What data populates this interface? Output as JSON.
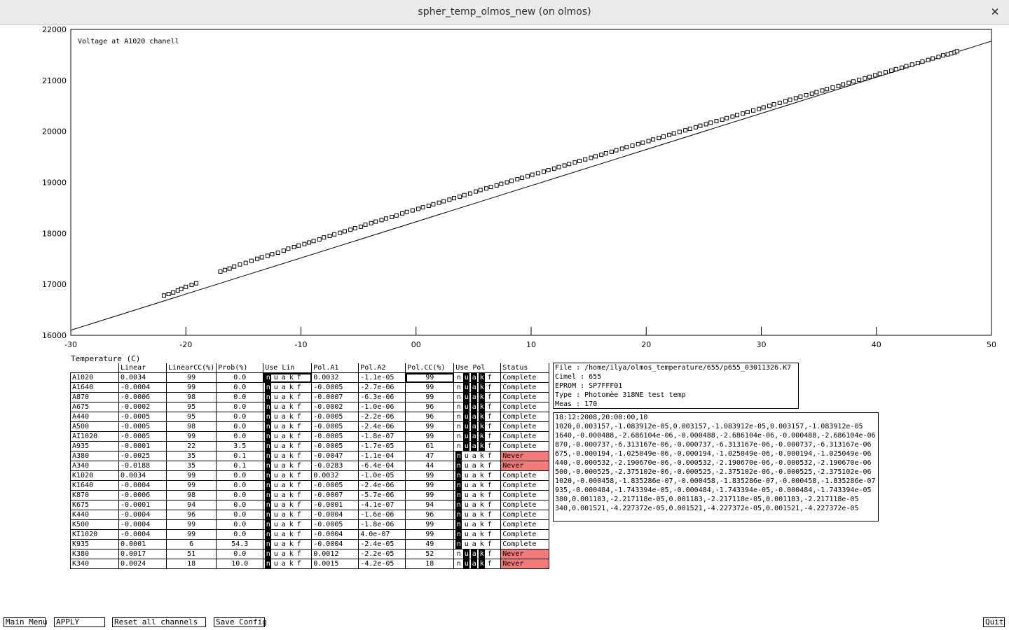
{
  "window": {
    "title": "spher_temp_olmos_new (on olmos)",
    "close_glyph": "✕"
  },
  "chart_data": {
    "type": "scatter",
    "annotation": "Voltage at A1020 chanell",
    "xlabel": "Temperature (C)",
    "ylabel": "",
    "xlim": [
      -30,
      50
    ],
    "ylim": [
      16000,
      22000
    ],
    "x_ticks": [
      "-30",
      "-20",
      "-10",
      "00",
      "10",
      "20",
      "30",
      "40",
      "50"
    ],
    "y_ticks": [
      "16000",
      "17000",
      "18000",
      "19000",
      "20000",
      "21000",
      "22000"
    ],
    "grid": false,
    "marker": "open-square",
    "fit_line": {
      "type": "linear",
      "x": [
        -30,
        50
      ],
      "y": [
        16100,
        21770
      ]
    },
    "scatter": {
      "x": [
        -21.9,
        -21.5,
        -21.1,
        -20.7,
        -20.4,
        -20.0,
        -19.5,
        -19.1,
        -17.0,
        -16.6,
        -16.2,
        -15.8,
        -15.3,
        -14.8,
        -14.3,
        -13.8,
        -13.4,
        -12.9,
        -12.5,
        -12.0,
        -11.5,
        -11.1,
        -10.6,
        -10.2,
        -9.7,
        -9.3,
        -8.9,
        -8.4,
        -8.0,
        -7.5,
        -7.1,
        -6.6,
        -6.2,
        -5.7,
        -5.3,
        -4.8,
        -4.4,
        -3.9,
        -3.5,
        -3.0,
        -2.6,
        -2.1,
        -1.7,
        -1.2,
        -0.8,
        -0.3,
        0.2,
        0.6,
        1.1,
        1.5,
        2.0,
        2.4,
        2.9,
        3.3,
        3.8,
        4.2,
        4.7,
        5.2,
        5.6,
        6.1,
        6.5,
        7.0,
        7.4,
        7.9,
        8.3,
        8.8,
        9.2,
        9.7,
        10.1,
        10.6,
        11.1,
        11.5,
        12.0,
        12.4,
        12.9,
        13.3,
        13.8,
        14.2,
        14.7,
        15.2,
        15.6,
        16.1,
        16.5,
        17.0,
        17.4,
        17.9,
        18.3,
        18.8,
        19.3,
        19.7,
        20.2,
        20.6,
        21.1,
        21.5,
        22.0,
        22.4,
        22.9,
        23.4,
        23.8,
        24.3,
        24.7,
        25.2,
        25.6,
        26.1,
        26.6,
        27.0,
        27.5,
        27.9,
        28.4,
        28.8,
        29.3,
        29.8,
        30.2,
        30.7,
        31.1,
        31.6,
        32.1,
        32.5,
        33.0,
        33.4,
        33.9,
        34.4,
        34.8,
        35.3,
        35.7,
        36.2,
        36.7,
        37.1,
        37.6,
        38.0,
        38.5,
        39.0,
        39.4,
        39.9,
        40.3,
        40.8,
        41.3,
        41.7,
        42.2,
        42.6,
        43.1,
        43.6,
        44.0,
        44.5,
        44.9,
        45.4,
        45.8,
        46.2,
        46.5,
        46.8,
        47.0
      ],
      "y": [
        16780,
        16810,
        16840,
        16880,
        16910,
        16950,
        16990,
        17020,
        17250,
        17280,
        17310,
        17350,
        17390,
        17420,
        17460,
        17500,
        17530,
        17560,
        17590,
        17620,
        17660,
        17700,
        17730,
        17760,
        17790,
        17820,
        17850,
        17880,
        17920,
        17950,
        17980,
        18010,
        18040,
        18070,
        18100,
        18130,
        18170,
        18200,
        18230,
        18260,
        18290,
        18320,
        18350,
        18390,
        18420,
        18450,
        18480,
        18510,
        18540,
        18570,
        18600,
        18630,
        18660,
        18690,
        18720,
        18750,
        18780,
        18820,
        18850,
        18880,
        18910,
        18940,
        18970,
        19000,
        19030,
        19060,
        19090,
        19120,
        19150,
        19180,
        19210,
        19240,
        19270,
        19300,
        19330,
        19360,
        19390,
        19420,
        19450,
        19480,
        19510,
        19540,
        19570,
        19600,
        19630,
        19660,
        19690,
        19720,
        19750,
        19780,
        19810,
        19840,
        19870,
        19900,
        19930,
        19960,
        19990,
        20020,
        20050,
        20080,
        20110,
        20140,
        20170,
        20200,
        20230,
        20260,
        20290,
        20320,
        20350,
        20380,
        20410,
        20440,
        20470,
        20500,
        20530,
        20560,
        20590,
        20620,
        20650,
        20680,
        20710,
        20740,
        20770,
        20800,
        20830,
        20860,
        20890,
        20920,
        20950,
        20980,
        21010,
        21040,
        21070,
        21100,
        21130,
        21160,
        21190,
        21220,
        21250,
        21280,
        21310,
        21340,
        21370,
        21400,
        21430,
        21460,
        21490,
        21510,
        21530,
        21550,
        21570,
        21590,
        21610
      ]
    }
  },
  "table": {
    "headers": [
      "",
      "Linear",
      "LinearCC(%)",
      "Prob(%)",
      "Use Lin",
      "Pol.A1",
      "Pol.A2",
      "Pol.CC(%)",
      "Use Pol",
      "Status"
    ],
    "toggle_letters": [
      "n",
      "u",
      "a",
      "k",
      "f"
    ],
    "rows": [
      {
        "ch": "A1020",
        "lin": "0.0034",
        "lincc": "99",
        "prob": "0.0",
        "uselin": "n",
        "a1": "0.0032",
        "a2": "-1.1e-05",
        "polcc": "99",
        "usepol": "uak",
        "status": "Complete"
      },
      {
        "ch": "A1640",
        "lin": "-0.0004",
        "lincc": "99",
        "prob": "0.0",
        "uselin": "n",
        "a1": "-0.0005",
        "a2": "-2.7e-06",
        "polcc": "99",
        "usepol": "uak",
        "status": "Complete"
      },
      {
        "ch": "A870",
        "lin": "-0.0006",
        "lincc": "98",
        "prob": "0.0",
        "uselin": "n",
        "a1": "-0.0007",
        "a2": "-6.3e-06",
        "polcc": "99",
        "usepol": "uak",
        "status": "Complete"
      },
      {
        "ch": "A675",
        "lin": "-0.0002",
        "lincc": "95",
        "prob": "0.0",
        "uselin": "n",
        "a1": "-0.0002",
        "a2": "-1.0e-06",
        "polcc": "96",
        "usepol": "uak",
        "status": "Complete"
      },
      {
        "ch": "A440",
        "lin": "-0.0005",
        "lincc": "95",
        "prob": "0.0",
        "uselin": "n",
        "a1": "-0.0005",
        "a2": "-2.2e-06",
        "polcc": "96",
        "usepol": "uak",
        "status": "Complete"
      },
      {
        "ch": "A500",
        "lin": "-0.0005",
        "lincc": "98",
        "prob": "0.0",
        "uselin": "n",
        "a1": "-0.0005",
        "a2": "-2.4e-06",
        "polcc": "99",
        "usepol": "uak",
        "status": "Complete"
      },
      {
        "ch": "AI1020",
        "lin": "-0.0005",
        "lincc": "99",
        "prob": "0.0",
        "uselin": "n",
        "a1": "-0.0005",
        "a2": "-1.8e-07",
        "polcc": "99",
        "usepol": "uak",
        "status": "Complete"
      },
      {
        "ch": "A935",
        "lin": "-0.0001",
        "lincc": "22",
        "prob": "3.5",
        "uselin": "n",
        "a1": "-0.0005",
        "a2": "-1.7e-05",
        "polcc": "61",
        "usepol": "uak",
        "status": "Complete"
      },
      {
        "ch": "A380",
        "lin": "-0.0025",
        "lincc": "35",
        "prob": "0.1",
        "uselin": "n",
        "a1": "-0.0047",
        "a2": "-1.1e-04",
        "polcc": "47",
        "usepol": "n",
        "status": "Never"
      },
      {
        "ch": "A340",
        "lin": "-0.0188",
        "lincc": "35",
        "prob": "0.1",
        "uselin": "n",
        "a1": "-0.0283",
        "a2": "-6.4e-04",
        "polcc": "44",
        "usepol": "n",
        "status": "Never"
      },
      {
        "ch": "K1020",
        "lin": "0.0034",
        "lincc": "99",
        "prob": "0.0",
        "uselin": "n",
        "a1": "0.0032",
        "a2": "-1.0e-05",
        "polcc": "99",
        "usepol": "n",
        "status": "Complete"
      },
      {
        "ch": "K1640",
        "lin": "-0.0004",
        "lincc": "99",
        "prob": "0.0",
        "uselin": "n",
        "a1": "-0.0005",
        "a2": "-2.4e-06",
        "polcc": "99",
        "usepol": "n",
        "status": "Complete"
      },
      {
        "ch": "K870",
        "lin": "-0.0006",
        "lincc": "98",
        "prob": "0.0",
        "uselin": "n",
        "a1": "-0.0007",
        "a2": "-5.7e-06",
        "polcc": "99",
        "usepol": "n",
        "status": "Complete"
      },
      {
        "ch": "K675",
        "lin": "-0.0001",
        "lincc": "94",
        "prob": "0.0",
        "uselin": "n",
        "a1": "-0.0001",
        "a2": "-4.1e-07",
        "polcc": "94",
        "usepol": "n",
        "status": "Complete"
      },
      {
        "ch": "K440",
        "lin": "-0.0004",
        "lincc": "96",
        "prob": "0.0",
        "uselin": "n",
        "a1": "-0.0004",
        "a2": "-1.6e-06",
        "polcc": "96",
        "usepol": "n",
        "status": "Complete"
      },
      {
        "ch": "K500",
        "lin": "-0.0004",
        "lincc": "99",
        "prob": "0.0",
        "uselin": "n",
        "a1": "-0.0005",
        "a2": "-1.8e-06",
        "polcc": "99",
        "usepol": "n",
        "status": "Complete"
      },
      {
        "ch": "KI1020",
        "lin": "-0.0004",
        "lincc": "99",
        "prob": "0.0",
        "uselin": "n",
        "a1": "-0.0004",
        "a2": "4.0e-07",
        "polcc": "99",
        "usepol": "n",
        "status": "Complete"
      },
      {
        "ch": "K935",
        "lin": "0.0001",
        "lincc": "6",
        "prob": "54.3",
        "uselin": "n",
        "a1": "-0.0004",
        "a2": "-2.4e-05",
        "polcc": "49",
        "usepol": "n",
        "status": "Complete"
      },
      {
        "ch": "K380",
        "lin": "0.0017",
        "lincc": "51",
        "prob": "0.0",
        "uselin": "n",
        "a1": "0.0012",
        "a2": "-2.2e-05",
        "polcc": "52",
        "usepol": "uak",
        "status": "Never"
      },
      {
        "ch": "K340",
        "lin": "0.0024",
        "lincc": "18",
        "prob": "10.0",
        "uselin": "n",
        "a1": "0.0015",
        "a2": "-4.2e-05",
        "polcc": "18",
        "usepol": "uak",
        "status": "Never"
      }
    ]
  },
  "file_info": {
    "lines": [
      "File  : /home/ilya/olmos_temperature/655/p655_03011326.K7",
      "Cimel : 655",
      "EPROM : SP7FFF01",
      "Type  :  Photomèe 318NE test temp",
      "Meas  : 170"
    ]
  },
  "coefficients": {
    "lines": [
      "18:12:2008,20:00:00,10",
      "1020,0.003157,-1.083912e-05,0.003157,-1.083912e-05,0.003157,-1.083912e-05",
      "1640,-0.000488,-2.686104e-06,-0.000488,-2.686104e-06,-0.000488,-2.686104e-06",
      "870,-0.000737,-6.313167e-06,-0.000737,-6.313167e-06,-0.000737,-6.313167e-06",
      "675,-0.000194,-1.025049e-06,-0.000194,-1.025049e-06,-0.000194,-1.025049e-06",
      "440,-0.000532,-2.190670e-06,-0.000532,-2.190670e-06,-0.000532,-2.190670e-06",
      "500,-0.000525,-2.375102e-06,-0.000525,-2.375102e-06,-0.000525,-2.375102e-06",
      "1020,-0.000458,-1.835286e-07,-0.000458,-1.835286e-07,-0.000458,-1.835286e-07",
      "935,-0.000484,-1.743394e-05,-0.000484,-1.743394e-05,-0.000484,-1.743394e-05",
      "380,0.001183,-2.217118e-05,0.001183,-2.217118e-05,0.001183,-2.217118e-05",
      "340,0.001521,-4.227372e-05,0.001521,-4.227372e-05,0.001521,-4.227372e-05"
    ]
  },
  "buttons": {
    "main_menu": "Main Menu",
    "apply": "APPLY",
    "reset": "Reset all channels",
    "save": "Save Config",
    "quit": "Quit"
  },
  "colors": {
    "never_bg": "#f47a7a",
    "toggle_on_bg": "#000000",
    "titlebar_bg": "#ebebeb"
  }
}
